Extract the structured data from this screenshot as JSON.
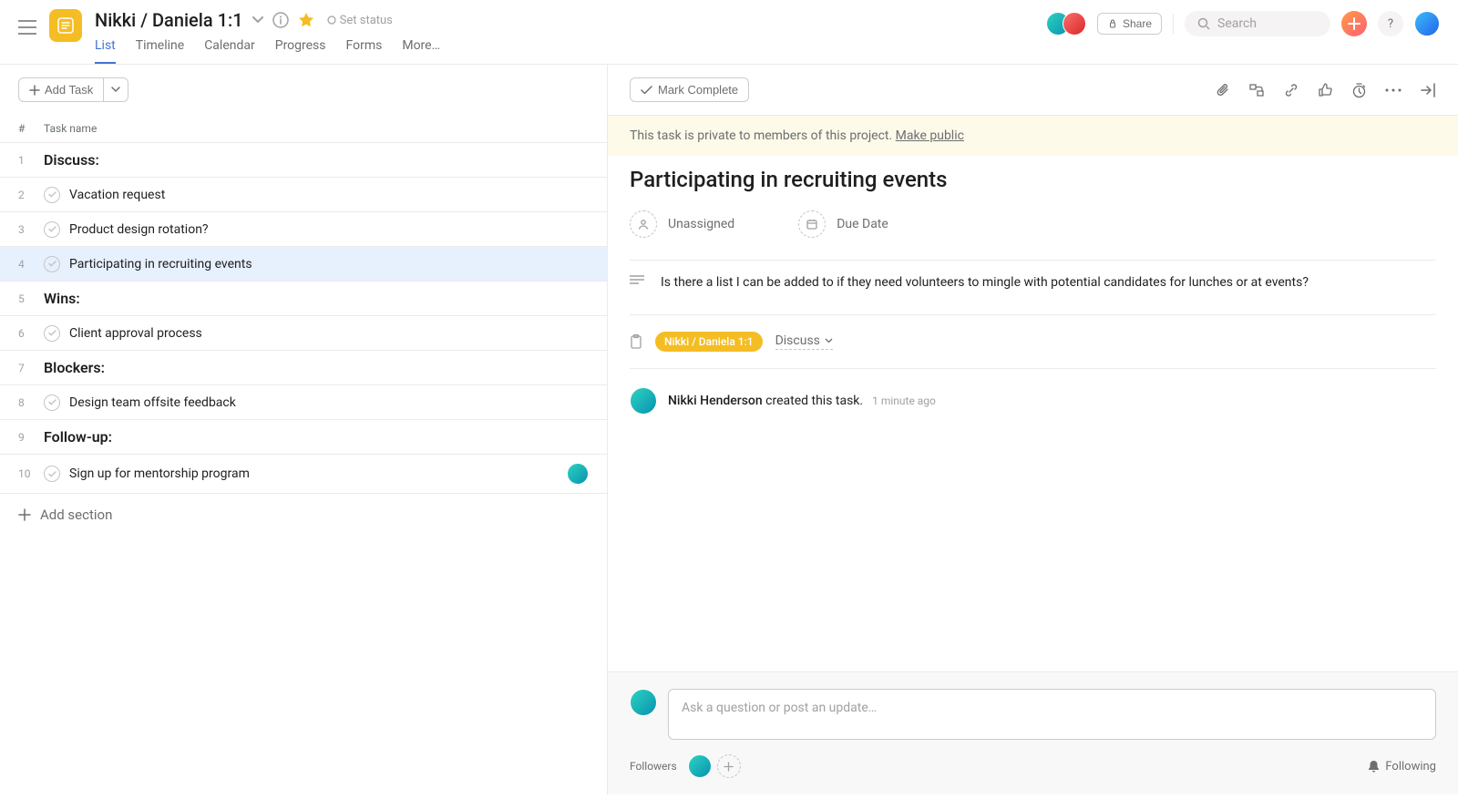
{
  "header": {
    "title": "Nikki / Daniela 1:1",
    "set_status": "Set status",
    "share": "Share",
    "search_placeholder": "Search",
    "tabs": [
      "List",
      "Timeline",
      "Calendar",
      "Progress",
      "Forms",
      "More…"
    ],
    "help": "?"
  },
  "toolbar": {
    "add_task": "Add Task"
  },
  "list": {
    "header_num": "#",
    "header_name": "Task name",
    "rows": [
      {
        "n": "1",
        "section": true,
        "name": "Discuss:"
      },
      {
        "n": "2",
        "section": false,
        "name": "Vacation request"
      },
      {
        "n": "3",
        "section": false,
        "name": "Product design rotation?"
      },
      {
        "n": "4",
        "section": false,
        "name": "Participating in recruiting events",
        "selected": true
      },
      {
        "n": "5",
        "section": true,
        "name": "Wins:"
      },
      {
        "n": "6",
        "section": false,
        "name": "Client approval process"
      },
      {
        "n": "7",
        "section": true,
        "name": "Blockers:"
      },
      {
        "n": "8",
        "section": false,
        "name": "Design team offsite feedback"
      },
      {
        "n": "9",
        "section": true,
        "name": "Follow-up:"
      },
      {
        "n": "10",
        "section": false,
        "name": "Sign up for mentorship program",
        "assignee": true
      }
    ],
    "add_section": "Add section"
  },
  "detail": {
    "mark_complete": "Mark Complete",
    "notice_text": "This task is private to members of this project. ",
    "notice_link": "Make public",
    "title": "Participating in recruiting events",
    "assignee_label": "Unassigned",
    "due_label": "Due Date",
    "description": "Is there a list I can be added to if they need volunteers to mingle with potential candidates for lunches or at events?",
    "project_pill": "Nikki / Daniela 1:1",
    "section_dd": "Discuss",
    "activity_author": "Nikki Henderson",
    "activity_action": "created this task.",
    "activity_time": "1 minute ago",
    "comment_placeholder": "Ask a question or post an update…",
    "followers_label": "Followers",
    "following": "Following"
  }
}
